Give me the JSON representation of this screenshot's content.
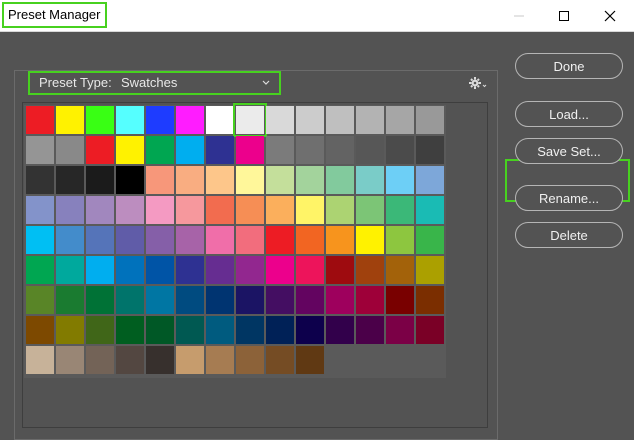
{
  "window": {
    "title": "Preset Manager"
  },
  "preset_type": {
    "label": "Preset Type:",
    "value": "Swatches"
  },
  "icons": {
    "gear": "gear-icon",
    "minimize": "minimize-icon",
    "maximize": "maximize-icon",
    "close": "close-icon",
    "chevron": "chevron-down-icon"
  },
  "buttons": {
    "done": "Done",
    "load": "Load...",
    "save_set": "Save Set...",
    "rename": "Rename...",
    "delete": "Delete"
  },
  "colors": {
    "highlight": "#47d11f",
    "background": "#535353"
  },
  "swatches": [
    [
      "#ed1c24",
      "#fff200",
      "#39ff14",
      "#55ffff",
      "#1e3cff",
      "#ff1cff",
      "#ffffff",
      "#ebebeb",
      "#d9d9d9",
      "#cccccc",
      "#bfbfbf",
      "#b3b3b3",
      "#a6a6a6",
      "#999999"
    ],
    [
      "#959595",
      "#898989",
      "#ed1c24",
      "#fff200",
      "#00a651",
      "#00aeef",
      "#2e3192",
      "#ec008c",
      "#7b7b7b",
      "#6f6f6f",
      "#636363",
      "#575757",
      "#4b4b4b",
      "#3f3f3f"
    ],
    [
      "#333333",
      "#272727",
      "#1b1b1b",
      "#000000",
      "#f7977a",
      "#f9ad81",
      "#fdc68a",
      "#fff79a",
      "#c4df9b",
      "#a3d39c",
      "#82ca9d",
      "#7accc8",
      "#6dcff6",
      "#7da7d9"
    ],
    [
      "#8393ca",
      "#8781bd",
      "#a187be",
      "#bc8dbf",
      "#f49ac2",
      "#f6989d",
      "#f26c4f",
      "#f68e55",
      "#fbaf5c",
      "#fff467",
      "#acd372",
      "#7cc576",
      "#3bb878",
      "#1abbb4"
    ],
    [
      "#00bff3",
      "#438ccb",
      "#5574b9",
      "#605ca8",
      "#855fa8",
      "#a763a8",
      "#f06ea9",
      "#f26d7d",
      "#ed1c24",
      "#f26522",
      "#f7941d",
      "#fff200",
      "#8dc63f",
      "#39b54a"
    ],
    [
      "#00a651",
      "#00a99d",
      "#00aeef",
      "#0072bc",
      "#0054a6",
      "#2e3192",
      "#662d91",
      "#92278f",
      "#ec008c",
      "#ed145b",
      "#9e0b0f",
      "#a0410d",
      "#a3620a",
      "#aba000"
    ],
    [
      "#598527",
      "#1a7b30",
      "#007236",
      "#00746b",
      "#0076a3",
      "#004b80",
      "#003471",
      "#1b1464",
      "#440e62",
      "#630460",
      "#9e005d",
      "#9e0039",
      "#790000",
      "#7b2e00"
    ],
    [
      "#7d4900",
      "#827b00",
      "#406618",
      "#005e20",
      "#005826",
      "#005952",
      "#005b7f",
      "#003663",
      "#002157",
      "#0d004c",
      "#32004b",
      "#4b0049",
      "#7b0046",
      "#7a0026"
    ],
    [
      "#c7b299",
      "#998675",
      "#736357",
      "#534741",
      "#37302d",
      "#c69c6d",
      "#a67c52",
      "#8c6239",
      "#754c24",
      "#603913"
    ]
  ]
}
